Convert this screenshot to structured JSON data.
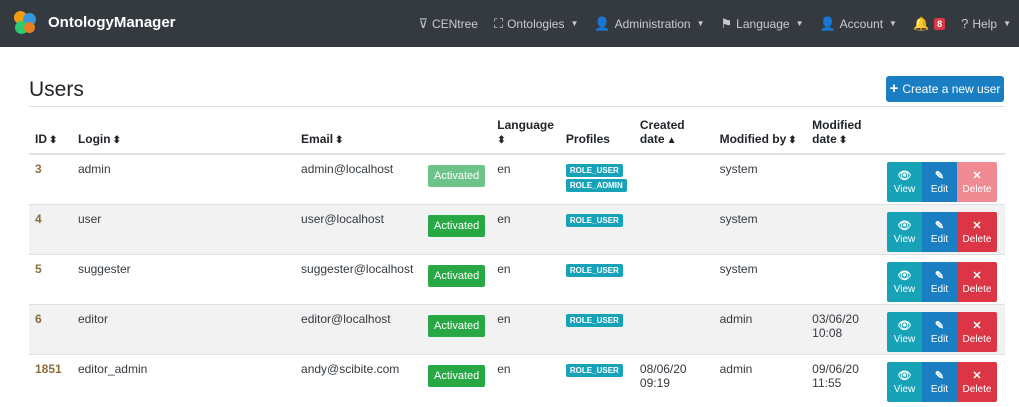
{
  "navbar": {
    "brand": "OntologyManager",
    "items": [
      {
        "icon": "filter-icon",
        "glyph": "⊽",
        "label": "CENtree",
        "caret": false
      },
      {
        "icon": "sitemap-icon",
        "glyph": "⛶",
        "label": "Ontologies",
        "caret": true
      },
      {
        "icon": "user-plus-icon",
        "glyph": "👤",
        "label": "Administration",
        "caret": true
      },
      {
        "icon": "flag-icon",
        "glyph": "⚑",
        "label": "Language",
        "caret": true
      },
      {
        "icon": "user-icon",
        "glyph": "👤",
        "label": "Account",
        "caret": true
      },
      {
        "icon": "bell-icon",
        "glyph": "🔔",
        "label": "",
        "badge": "8",
        "caret": false
      },
      {
        "icon": "question-icon",
        "glyph": "?",
        "label": "Help",
        "caret": true
      }
    ]
  },
  "page": {
    "title": "Users",
    "create_button": "Create a new user"
  },
  "table": {
    "headers": {
      "id": "ID",
      "login": "Login",
      "email": "Email",
      "language": "Language",
      "profiles": "Profiles",
      "created": "Created date",
      "modified_by": "Modified by",
      "modified": "Modified date"
    },
    "rows": [
      {
        "id": "3",
        "login": "admin",
        "email": "admin@localhost",
        "status": "Activated",
        "language": "en",
        "profiles": [
          "ROLE_USER",
          "ROLE_ADMIN"
        ],
        "created": "",
        "modified_by": "system",
        "modified": "",
        "dim": true
      },
      {
        "id": "4",
        "login": "user",
        "email": "user@localhost",
        "status": "Activated",
        "language": "en",
        "profiles": [
          "ROLE_USER"
        ],
        "created": "",
        "modified_by": "system",
        "modified": "",
        "dim": false
      },
      {
        "id": "5",
        "login": "suggester",
        "email": "suggester@localhost",
        "status": "Activated",
        "language": "en",
        "profiles": [
          "ROLE_USER"
        ],
        "created": "",
        "modified_by": "system",
        "modified": "",
        "dim": false
      },
      {
        "id": "6",
        "login": "editor",
        "email": "editor@localhost",
        "status": "Activated",
        "language": "en",
        "profiles": [
          "ROLE_USER"
        ],
        "created": "",
        "modified_by": "admin",
        "modified": "03/06/20 10:08",
        "dim": false
      },
      {
        "id": "1851",
        "login": "editor_admin",
        "email": "andy@scibite.com",
        "status": "Activated",
        "language": "en",
        "profiles": [
          "ROLE_USER"
        ],
        "created": "08/06/20 09:19",
        "modified_by": "admin",
        "modified": "09/06/20 11:55",
        "dim": false
      }
    ],
    "actions": {
      "view": "View",
      "edit": "Edit",
      "delete": "Delete"
    }
  },
  "colors": {
    "navbar": "#343a40",
    "primary": "#1a7fc2",
    "success": "#28a745",
    "info": "#17a2b8",
    "danger": "#dc3545"
  }
}
